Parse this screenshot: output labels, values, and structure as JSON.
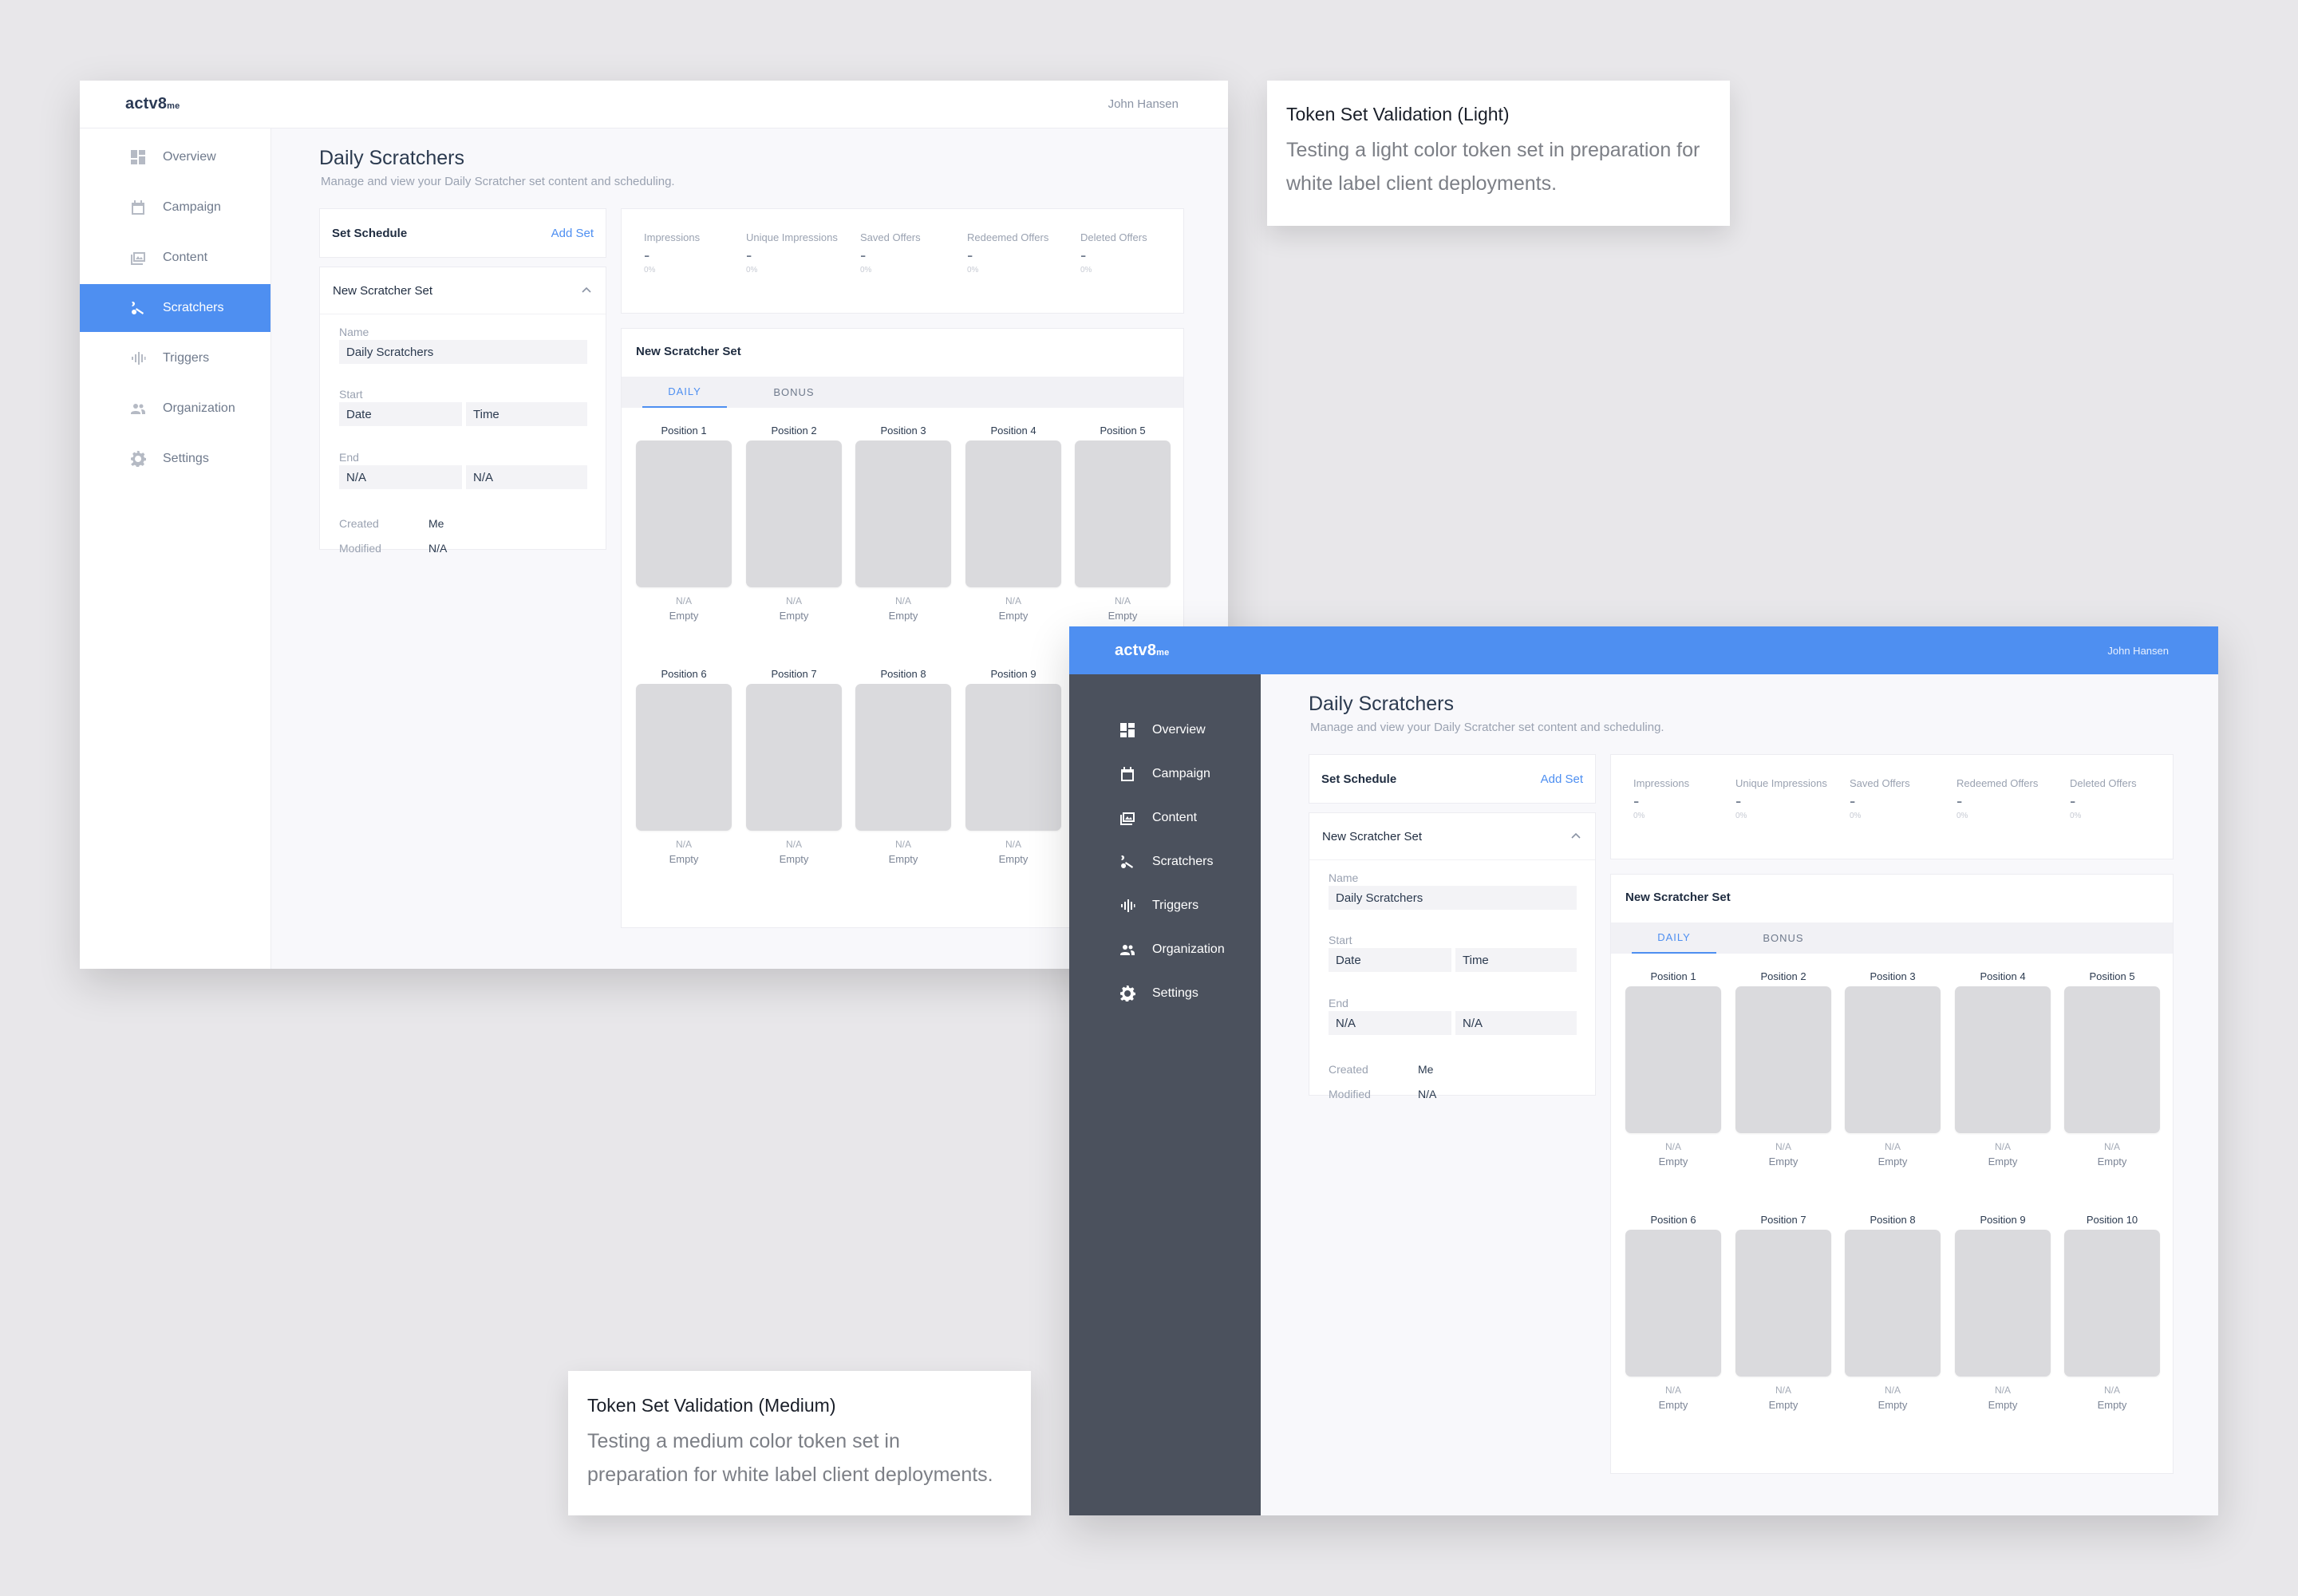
{
  "screens": {
    "light": {
      "logo": "actv8",
      "logo_suffix": "me",
      "user": "John Hansen",
      "nav": [
        "Overview",
        "Campaign",
        "Content",
        "Scratchers",
        "Triggers",
        "Organization",
        "Settings"
      ],
      "active_nav": "Scratchers"
    },
    "medium": {
      "logo": "actv8",
      "logo_suffix": "me",
      "user": "John Hansen",
      "nav": [
        "Overview",
        "Campaign",
        "Content",
        "Scratchers",
        "Triggers",
        "Organization",
        "Settings"
      ]
    }
  },
  "page": {
    "title": "Daily Scratchers",
    "subtitle": "Manage and view your Daily Scratcher set content and scheduling."
  },
  "schedule": {
    "title": "Set Schedule",
    "add_label": "Add Set"
  },
  "set_panel": {
    "title": "New Scratcher Set",
    "name_label": "Name",
    "name_value": "Daily Scratchers",
    "start_label": "Start",
    "start_date": "Date",
    "start_time": "Time",
    "end_label": "End",
    "end_date": "N/A",
    "end_time": "N/A",
    "created_label": "Created",
    "created_value": "Me",
    "modified_label": "Modified",
    "modified_value": "N/A"
  },
  "stats": [
    {
      "label": "Impressions",
      "value": "-",
      "pct": "0%"
    },
    {
      "label": "Unique Impressions",
      "value": "-",
      "pct": "0%"
    },
    {
      "label": "Saved Offers",
      "value": "-",
      "pct": "0%"
    },
    {
      "label": "Redeemed Offers",
      "value": "-",
      "pct": "0%"
    },
    {
      "label": "Deleted Offers",
      "value": "-",
      "pct": "0%"
    }
  ],
  "grid": {
    "title": "New Scratcher Set",
    "tabs": [
      "DAILY",
      "BONUS"
    ],
    "active_tab": "DAILY",
    "positions": [
      {
        "label": "Position 1",
        "value": "N/A",
        "status": "Empty"
      },
      {
        "label": "Position 2",
        "value": "N/A",
        "status": "Empty"
      },
      {
        "label": "Position 3",
        "value": "N/A",
        "status": "Empty"
      },
      {
        "label": "Position 4",
        "value": "N/A",
        "status": "Empty"
      },
      {
        "label": "Position 5",
        "value": "N/A",
        "status": "Empty"
      },
      {
        "label": "Position 6",
        "value": "N/A",
        "status": "Empty"
      },
      {
        "label": "Position 7",
        "value": "N/A",
        "status": "Empty"
      },
      {
        "label": "Position 8",
        "value": "N/A",
        "status": "Empty"
      },
      {
        "label": "Position 9",
        "value": "N/A",
        "status": "Empty"
      },
      {
        "label": "Position 10",
        "value": "N/A",
        "status": "Empty"
      }
    ]
  },
  "notes": {
    "light": {
      "title": "Token Set Validation (Light)",
      "desc_line1": "Testing a light color token set in preparation for",
      "desc_line2": "white label client deployments."
    },
    "medium": {
      "title": "Token Set Validation (Medium)",
      "desc_line1": "Testing a medium color token set in",
      "desc_line2": "preparation for white label client deployments."
    }
  },
  "colors": {
    "accent": "#4e8ff1",
    "sidebar_medium": "#4b515d",
    "placeholder": "#dadadd",
    "background": "#e8e7ea"
  },
  "icons": [
    "overview-icon",
    "calendar-icon",
    "content-icon",
    "scratcher-icon",
    "trigger-icon",
    "organization-icon",
    "gear-icon",
    "chevron-up-icon"
  ]
}
